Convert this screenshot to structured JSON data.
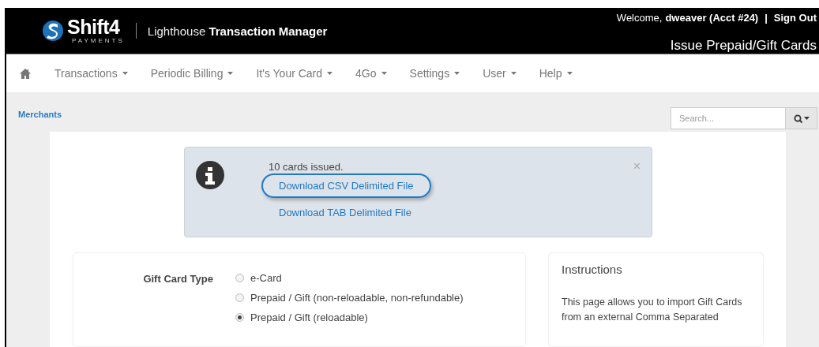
{
  "header": {
    "logo_text": "Shift4",
    "logo_subtext": "PAYMENTS",
    "app_title_light": "Lighthouse",
    "app_title_bold": "Transaction Manager",
    "welcome": "Welcome,",
    "user": "dweaver (Acct #24)",
    "separator": "|",
    "sign_out": "Sign Out",
    "page_title": "Issue Prepaid/Gift Cards"
  },
  "nav": {
    "items": [
      {
        "label": "Transactions"
      },
      {
        "label": "Periodic Billing"
      },
      {
        "label": "It's Your Card"
      },
      {
        "label": "4Go"
      },
      {
        "label": "Settings"
      },
      {
        "label": "User"
      },
      {
        "label": "Help"
      }
    ]
  },
  "breadcrumb": "Merchants",
  "search": {
    "placeholder": "Search..."
  },
  "alert": {
    "message": "10 cards issued.",
    "close": "×",
    "links": [
      {
        "label": "Download CSV Delimited File",
        "highlighted": true
      },
      {
        "label": "Download TAB Delimited File",
        "highlighted": false
      }
    ]
  },
  "form": {
    "label": "Gift Card Type",
    "options": [
      {
        "label": "e-Card",
        "selected": false
      },
      {
        "label": "Prepaid / Gift (non-reloadable, non-refundable)",
        "selected": false
      },
      {
        "label": "Prepaid / Gift (reloadable)",
        "selected": true
      }
    ]
  },
  "instructions": {
    "title": "Instructions",
    "text": "This page allows you to import Gift Cards from an external Comma Separated"
  }
}
